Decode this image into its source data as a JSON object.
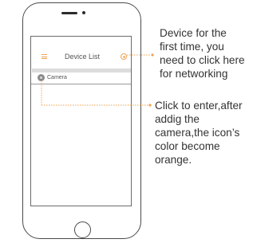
{
  "app": {
    "header_title": "Device List",
    "menu_icon": "hamburger-menu-icon",
    "add_icon": "plus-circle-icon",
    "devices": [
      {
        "name": "Camera",
        "icon": "camera-device-icon"
      }
    ]
  },
  "annotations": {
    "networking": [
      "Device for the",
      "first time, you",
      "need to click here",
      "for networking"
    ],
    "enter_camera": [
      "Click to enter,after",
      "addig the",
      "camera,the icon’s",
      "color become",
      "orange."
    ]
  },
  "colors": {
    "accent": "#f0a252",
    "text": "#333333",
    "outline": "#4a4a4a",
    "device_icon": "#8c8c8c"
  }
}
